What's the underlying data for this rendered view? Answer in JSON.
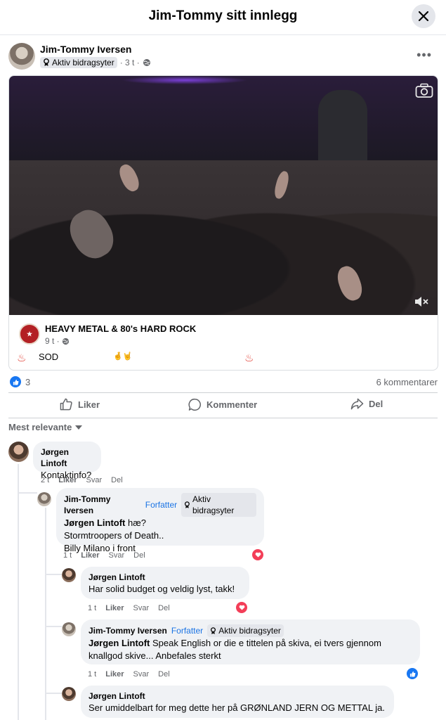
{
  "header": {
    "title": "Jim-Tommy sitt innlegg",
    "close_icon": "close-icon"
  },
  "post": {
    "author": "Jim-Tommy Iversen",
    "badge": "Aktiv bidragsyter",
    "time": "· 3 t ·",
    "more_icon": "more-horizontal-icon",
    "shared": {
      "group_name": "HEAVY METAL & 80's HARD ROCK",
      "group_time": "9 t ·",
      "text_sod": "SOD",
      "emoji_left": "♨",
      "emoji_hands": "🤞🤘",
      "emoji_right": "♨"
    },
    "likes": "3",
    "comments": "6 kommentarer",
    "actions": {
      "like": "Liker",
      "comment": "Kommenter",
      "share": "Del"
    }
  },
  "sort_label": "Mest relevante",
  "comments": [
    {
      "name": "Jørgen Lintoft",
      "text": "Kontaktinfo?",
      "time": "2 t",
      "like": "Liker",
      "reply": "Svar",
      "share": "Del"
    },
    {
      "name": "Jim-Tommy Iversen",
      "role": "Forfatter",
      "badge": "Aktiv bidragsyter",
      "mention": "Jørgen Lintoft",
      "line1": " hæ?",
      "line2": "Stormtroopers of Death..",
      "line3": "Billy Milano i front",
      "time": "1 t",
      "like": "Liker",
      "reply": "Svar",
      "share": "Del"
    },
    {
      "name": "Jørgen Lintoft",
      "text": "Har solid budget og veldig lyst, takk!",
      "time": "1 t",
      "like": "Liker",
      "reply": "Svar",
      "share": "Del"
    },
    {
      "name": "Jim-Tommy Iversen",
      "role": "Forfatter",
      "badge": "Aktiv bidragsyter",
      "mention": "Jørgen Lintoft",
      "line1": " Speak English or die e tittelen på skiva, ei tvers gjennom",
      "line2": "knallgod skive... Anbefales sterkt",
      "time": "1 t",
      "like": "Liker",
      "reply": "Svar",
      "share": "Del"
    },
    {
      "name": "Jørgen Lintoft",
      "text": "Ser umiddelbart for meg dette her på GRØNLAND JERN OG METTAL ja."
    }
  ],
  "colors": {
    "accent": "#1877f2",
    "heart": "#f33e58",
    "muted": "#65676b",
    "bubble": "#f0f2f5"
  }
}
